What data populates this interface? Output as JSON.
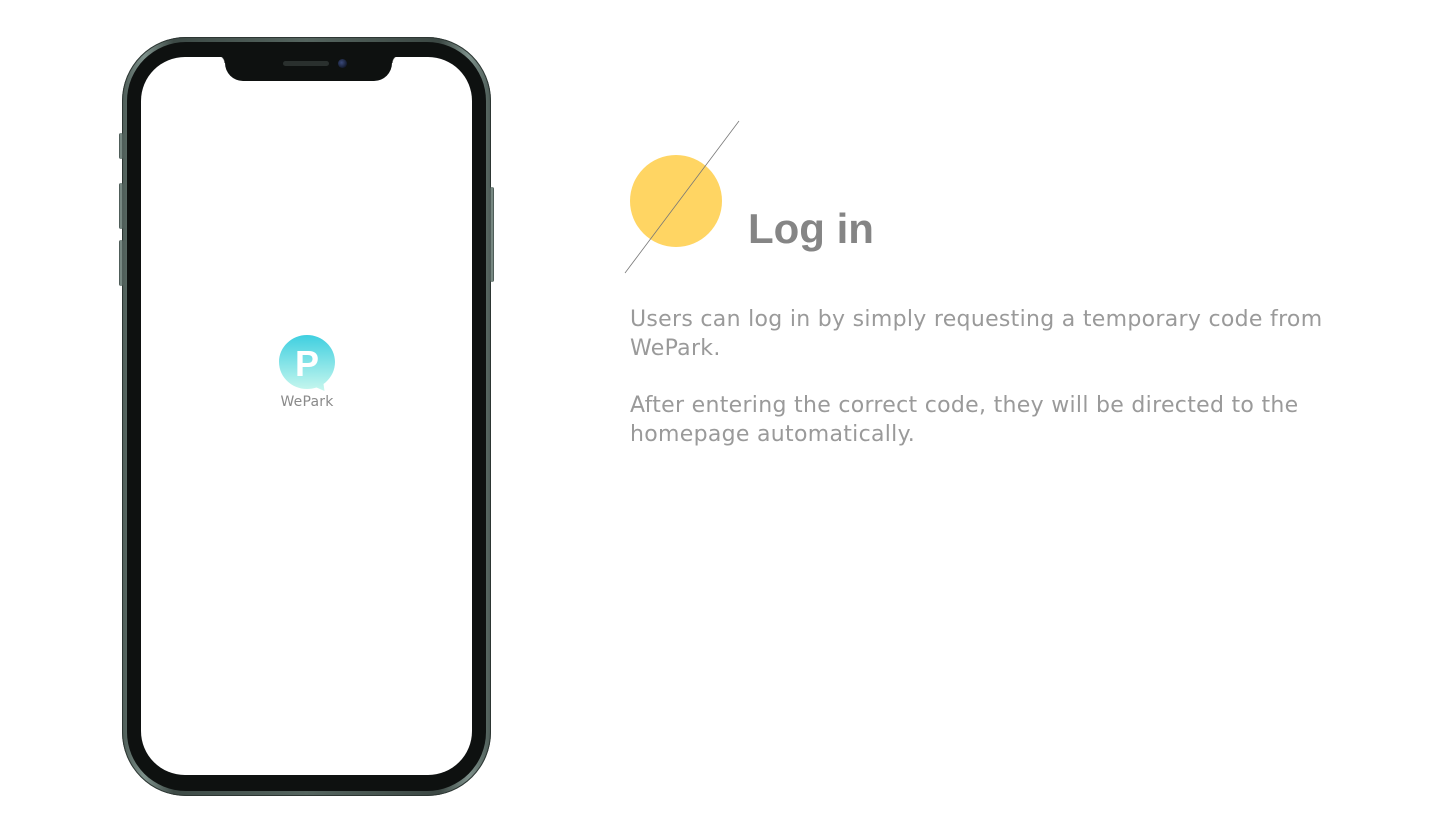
{
  "app": {
    "name": "WePark",
    "logo_letter": "P",
    "logo_gradient": [
      "#3fcfe0",
      "#c8f7ee"
    ]
  },
  "content": {
    "heading": "Log in",
    "paragraph_1": "Users can log in by simply requesting a temporary code from WePark.",
    "paragraph_2": "After entering the correct code, they will be directed to the homepage automatically."
  },
  "colors": {
    "accent_circle": "#ffd563",
    "heading_text": "#858585",
    "body_text": "#9a9a9a",
    "phone_frame": "#55655f"
  }
}
